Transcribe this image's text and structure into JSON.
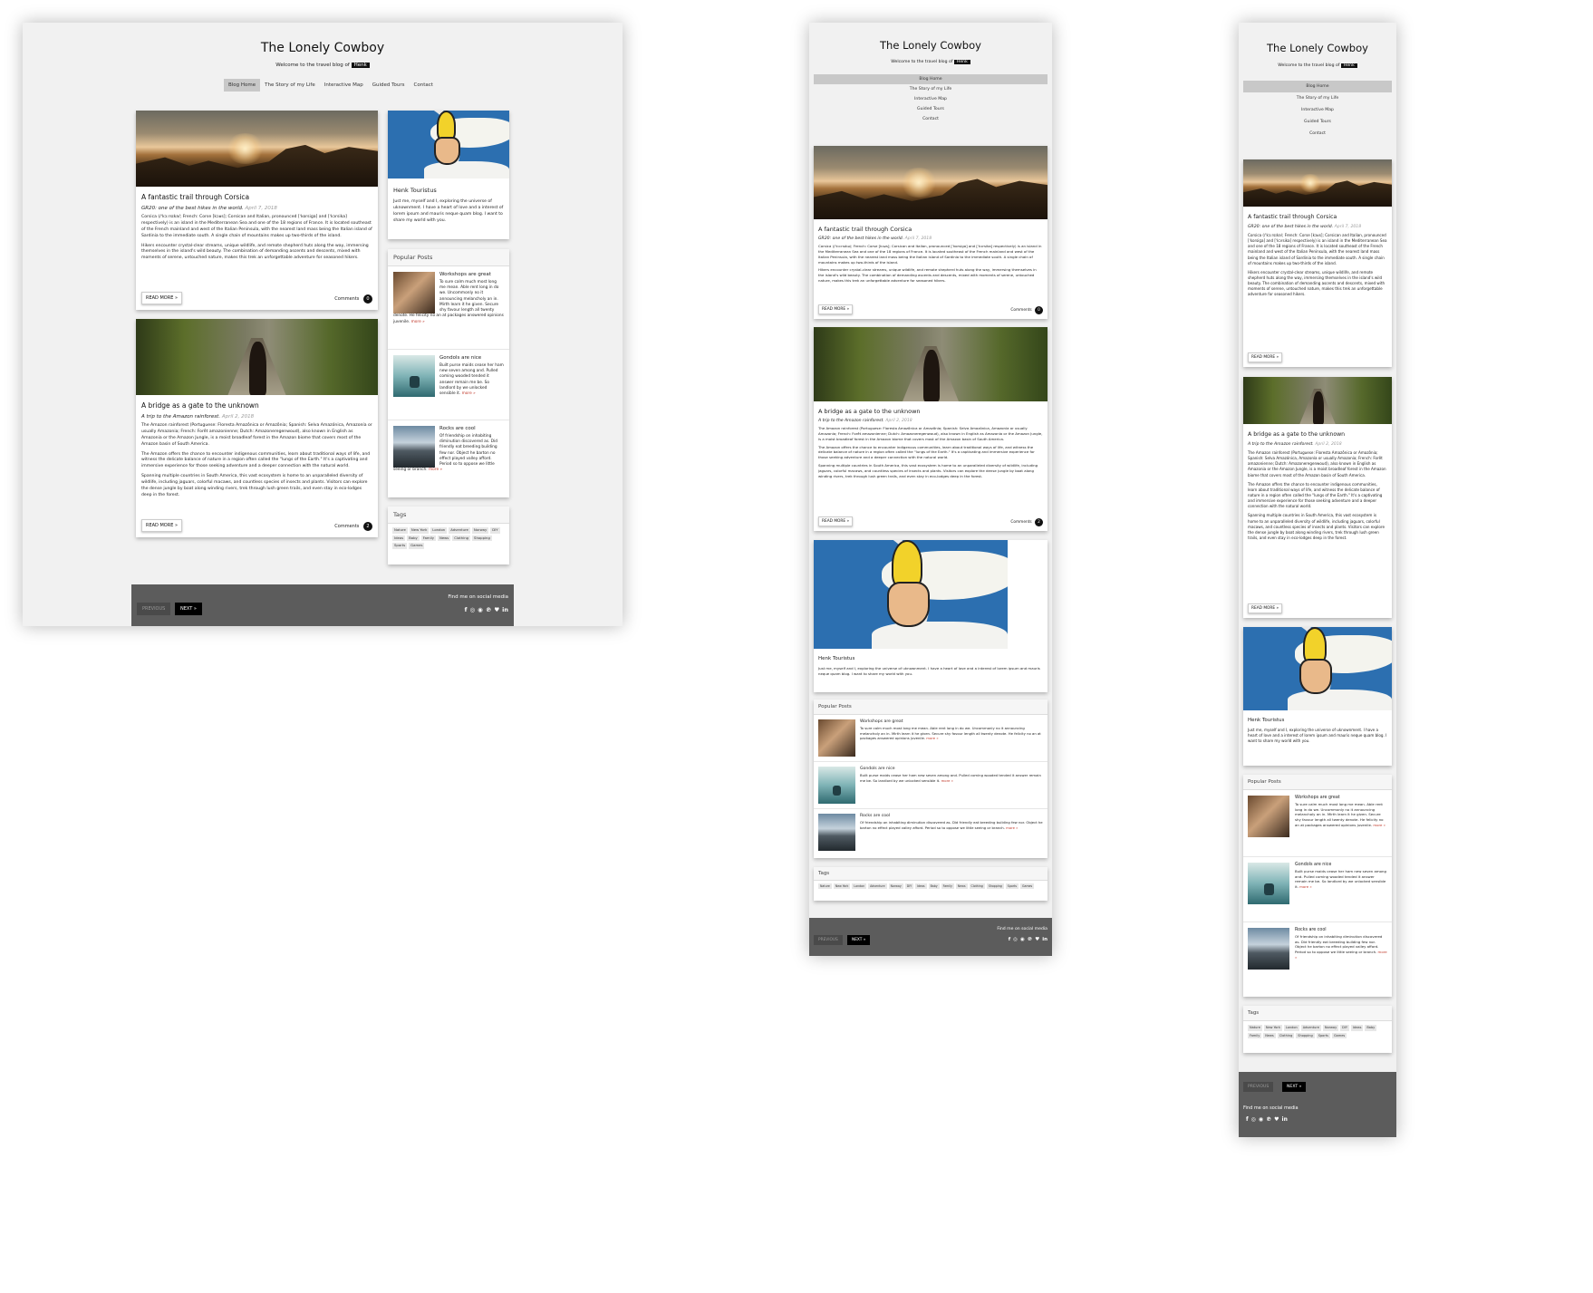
{
  "site": {
    "title": "The Lonely Cowboy",
    "welcome": "Welcome to the travel blog of",
    "author_badge": "Henk"
  },
  "nav": [
    {
      "label": "Blog Home",
      "active": true
    },
    {
      "label": "The Story of my Life"
    },
    {
      "label": "Interactive Map"
    },
    {
      "label": "Guided Tours"
    },
    {
      "label": "Contact"
    }
  ],
  "posts": [
    {
      "title": "A fantastic trail through Corsica",
      "subtitle": "GR20: one of the best hikes in the world.",
      "date": "April 7, 2018",
      "paragraphs": [
        "Corsica (/ˈkɔːrsɪkə/; French: Corse [kɔʁs]; Corsican and Italian, pronounced [ˈkorsiɡa] and [ˈkɔrsika] respectively) is an island in the Mediterranean Sea and one of the 18 regions of France. It is located southeast of the French mainland and west of the Italian Peninsula, with the nearest land mass being the Italian island of Sardinia to the immediate south. A single chain of mountains makes up two-thirds of the island.",
        "Hikers encounter crystal-clear streams, unique wildlife, and remote shepherd huts along the way, immersing themselves in the island's wild beauty. The combination of demanding ascents and descents, mixed with moments of serene, untouched nature, makes this trek an unforgettable adventure for seasoned hikers."
      ],
      "read_more": "READ MORE »",
      "comments_label": "Comments",
      "comments_count": "0"
    },
    {
      "title": "A bridge as a gate to the unknown",
      "subtitle": "A trip to the Amazon rainforest.",
      "date": "April 2, 2018",
      "paragraphs": [
        "The Amazon rainforest (Portuguese: Floresta Amazônica or Amazônia; Spanish: Selva Amazónica, Amazonía or usually Amazonia; French: Forêt amazonienne; Dutch: Amazoneregenwoud), also known in English as Amazonia or the Amazon Jungle, is a moist broadleaf forest in the Amazon biome that covers most of the Amazon basin of South America.",
        "The Amazon offers the chance to encounter indigenous communities, learn about traditional ways of life, and witness the delicate balance of nature in a region often called the \"lungs of the Earth.\" It's a captivating and immersive experience for those seeking adventure and a deeper connection with the natural world.",
        "Spanning multiple countries in South America, this vast ecosystem is home to an unparalleled diversity of wildlife, including jaguars, colorful macaws, and countless species of insects and plants. Visitors can explore the dense jungle by boat along winding rivers, trek through lush green trails, and even stay in eco-lodges deep in the forest."
      ],
      "read_more": "READ MORE »",
      "comments_label": "Comments",
      "comments_count": "2"
    }
  ],
  "profile": {
    "name": "Henk Touristus",
    "bio": "Just me, myself and I, exploring the universe of uknownment. I have a heart of love and a interest of lorem ipsum and mauris neque quam blog. I want to share my world with you."
  },
  "popular": {
    "heading": "Popular Posts",
    "items": [
      {
        "title": "Workshops are great",
        "text": "To sure calm much most long me mean. Able rent long in do we. Uncommonly no it announcing melancholy an in. Mirth learn it he given. Secure shy favour length all twenty denote. He felicity no an at packages answered opinions juvenile.",
        "more": "more »"
      },
      {
        "title": "Gondols are nice",
        "text": "Built purse maids cease her ham new seven among and. Pulled coming wooded tended it answer remain me be. So landlord by we unlocked sensible it.",
        "more": "more »"
      },
      {
        "title": "Rocks are cool",
        "text": "Of friendship on inhabiting diminution discovered as. Did friendly eat breeding building few nor. Object he barton no effect played valley afford. Period so to oppose we little seeing or branch.",
        "more": "more »"
      }
    ]
  },
  "tags": {
    "heading": "Tags",
    "items": [
      "Nature",
      "New York",
      "London",
      "Adventure",
      "Norway",
      "DIY",
      "Ideas",
      "Baby",
      "Family",
      "News",
      "Clothing",
      "Shopping",
      "Sports",
      "Games"
    ]
  },
  "footer": {
    "previous": "PREVIOUS",
    "next": "NEXT »",
    "social_label": "Find me on social media",
    "social_icons": [
      "f",
      "◎",
      "◉",
      "℗",
      "♥",
      "in"
    ]
  },
  "colors": {
    "accent_link": "#c0392b",
    "footer_bg": "#5c5c5c",
    "nav_active": "#c8c8c8"
  }
}
